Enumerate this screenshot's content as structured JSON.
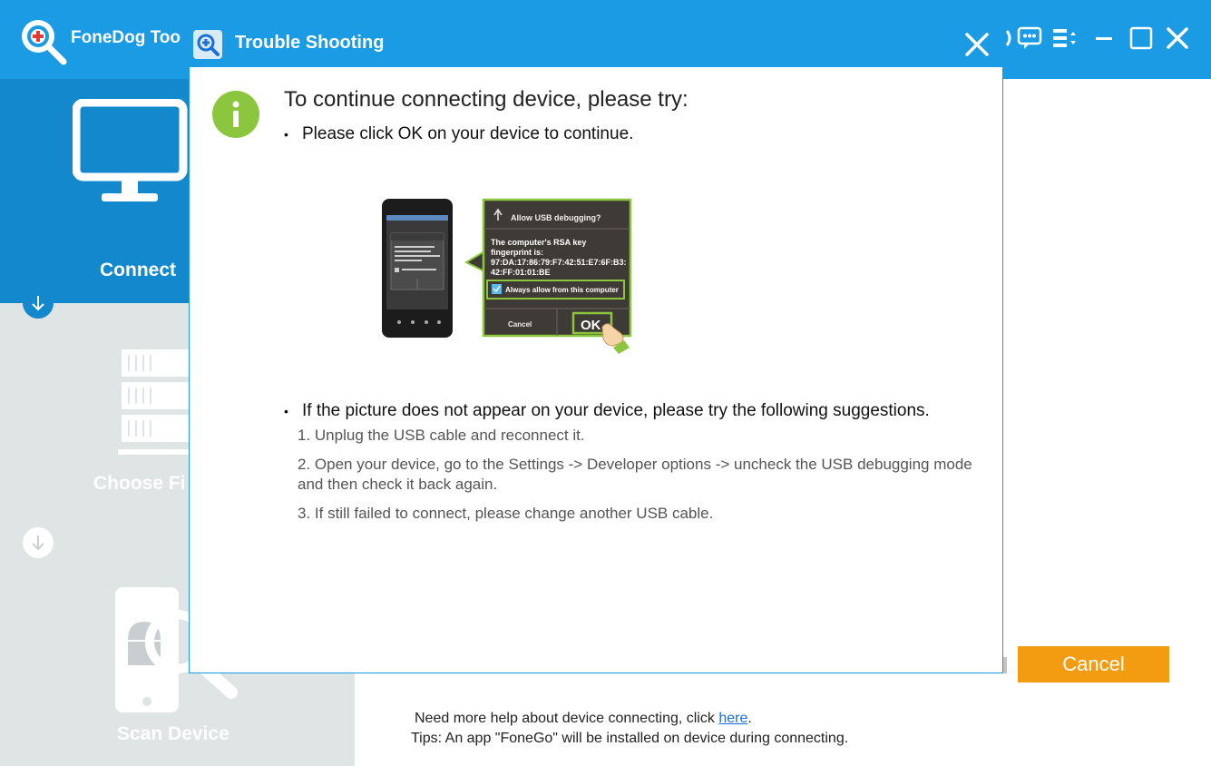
{
  "app": {
    "title": "FoneDog Too"
  },
  "sidebar": {
    "steps": [
      {
        "label": "Connect"
      },
      {
        "label": "Choose Fi"
      },
      {
        "label": "Scan Device"
      }
    ]
  },
  "main": {
    "help_prefix": "Need more help about device connecting, click ",
    "help_link": "here",
    "help_suffix": ".",
    "tips": "Tips: An app \"FoneGo\" will be installed on device during connecting.",
    "cancel_label": "Cancel"
  },
  "dialog": {
    "title": "Trouble Shooting",
    "heading": "To continue connecting device, please try:",
    "bullet1": "Please click OK on your device to continue.",
    "bullet2": "If the picture does not appear on your device, please try the following suggestions.",
    "suggestions": [
      "1. Unplug the USB cable and reconnect it.",
      "2. Open your device, go to the Settings -> Developer options -> uncheck the USB debugging mode and then check it back again.",
      "3. If still failed to connect, please change another USB cable."
    ],
    "illustration": {
      "popup_title": "Allow USB debugging?",
      "line1": "The computer's RSA key",
      "line2": "fingerprint is:",
      "line3": "97:DA:17:86:79:F7:42:51:E7:6F:B3:",
      "line4": "42:FF:01:01:BE",
      "checkbox_label": "Always allow from this computer",
      "cancel": "Cancel",
      "ok": "OK"
    }
  },
  "colors": {
    "brand_blue": "#1a9be3",
    "sidebar_active": "#1488cc",
    "accent_orange": "#f39c12",
    "info_green": "#8cc63f"
  }
}
